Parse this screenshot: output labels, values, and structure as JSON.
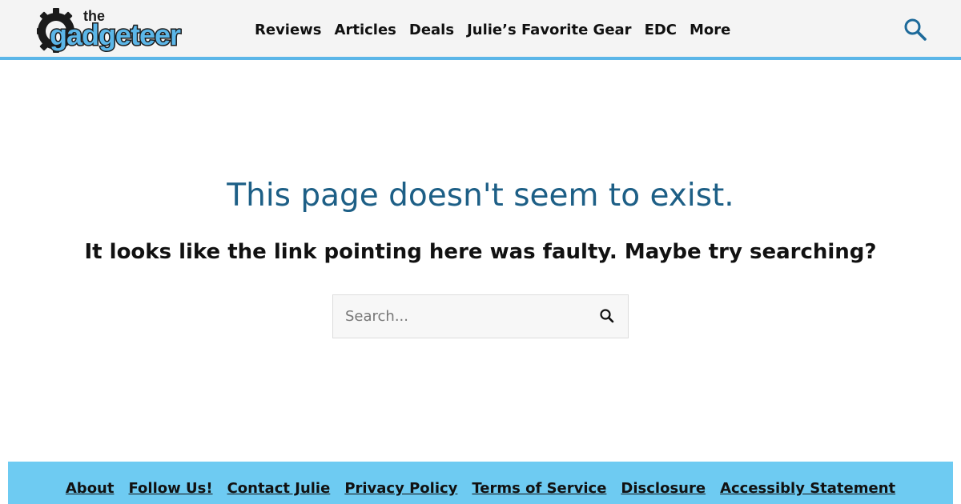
{
  "header": {
    "logo": {
      "small_text": "the",
      "main_text": "gadgeteer"
    },
    "nav": [
      {
        "label": "Reviews"
      },
      {
        "label": "Articles"
      },
      {
        "label": "Deals"
      },
      {
        "label": "Julie’s Favorite Gear"
      },
      {
        "label": "EDC"
      },
      {
        "label": "More"
      }
    ],
    "search_icon": "search-icon"
  },
  "main": {
    "title": "This page doesn't seem to exist.",
    "subtitle": "It looks like the link pointing here was faulty. Maybe try searching?",
    "search": {
      "placeholder": "Search...",
      "value": "",
      "submit_icon": "search-icon"
    }
  },
  "footer": {
    "links": [
      {
        "label": "About"
      },
      {
        "label": "Follow Us!"
      },
      {
        "label": "Contact Julie"
      },
      {
        "label": "Privacy Policy"
      },
      {
        "label": "Terms of Service"
      },
      {
        "label": "Disclosure"
      },
      {
        "label": "Accessibly Statement"
      }
    ]
  },
  "colors": {
    "header_bg": "#f4f4f4",
    "header_border": "#5bb6e8",
    "title": "#1d5f86",
    "icon_accent": "#1d6a9a",
    "footer_bg": "#6ecbf2",
    "logo_fill": "#5bb6e8",
    "logo_outline": "#1b1b1b"
  }
}
